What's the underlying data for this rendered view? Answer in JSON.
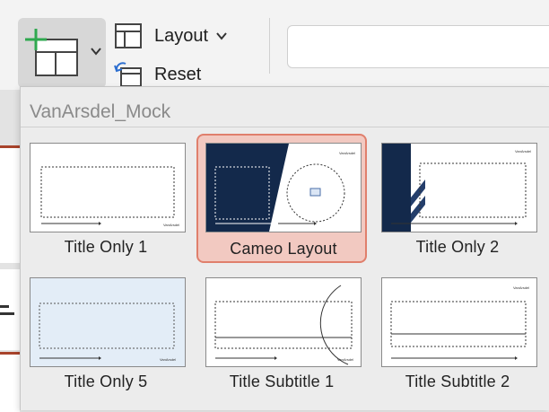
{
  "ribbon": {
    "layout_label": "Layout",
    "reset_label": "Reset"
  },
  "gallery": {
    "title": "VanArsdel_Mock",
    "logo_text": "VanArsdel",
    "layouts": [
      {
        "name": "Title Only 1",
        "selected": false
      },
      {
        "name": "Cameo Layout",
        "selected": true
      },
      {
        "name": "Title Only 2",
        "selected": false
      },
      {
        "name": "Title Only 5",
        "selected": false
      },
      {
        "name": "Title Subtitle 1",
        "selected": false
      },
      {
        "name": "Title Subtitle 2",
        "selected": false
      }
    ]
  },
  "colors": {
    "navy": "#13294b",
    "selection_fill": "#f2c9c1",
    "selection_border": "#e07f6c",
    "new_slide_plus": "#2fa84f",
    "accent_rule": "#a8432b",
    "title5_bg": "#e3edf7"
  },
  "icons": {
    "new_slide": "new-slide-icon",
    "layout": "layout-icon",
    "reset": "reset-icon"
  }
}
